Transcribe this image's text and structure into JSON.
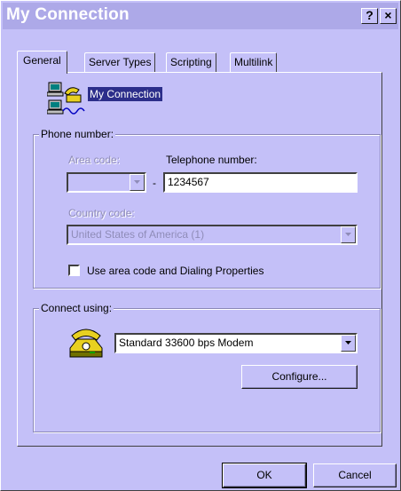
{
  "window": {
    "title": "My Connection",
    "help_button": "?",
    "close_button": "×"
  },
  "tabs": [
    {
      "label": "General",
      "active": true
    },
    {
      "label": "Server Types",
      "active": false
    },
    {
      "label": "Scripting",
      "active": false
    },
    {
      "label": "Multilink",
      "active": false
    }
  ],
  "general": {
    "icon": "dialup-network-icon",
    "connection_name": "My Connection",
    "phone_group": {
      "legend": "Phone number:",
      "area_code_label": "Area code:",
      "area_code_value": "",
      "dash": "-",
      "telephone_label": "Telephone number:",
      "telephone_value": "1234567",
      "country_code_label": "Country code:",
      "country_code_value": "United States of America (1)",
      "use_area_code_label": "Use area code and Dialing Properties",
      "use_area_code_checked": false
    },
    "connect_group": {
      "legend": "Connect using:",
      "icon": "modem-phone-icon",
      "modem": "Standard 33600 bps Modem",
      "configure_label": "Configure..."
    }
  },
  "buttons": {
    "ok": "OK",
    "cancel": "Cancel"
  },
  "colors": {
    "window_bg": "#c4c0f8",
    "titlebar_bg": "#ada9e8",
    "selection_bg": "#2c2e8a"
  }
}
